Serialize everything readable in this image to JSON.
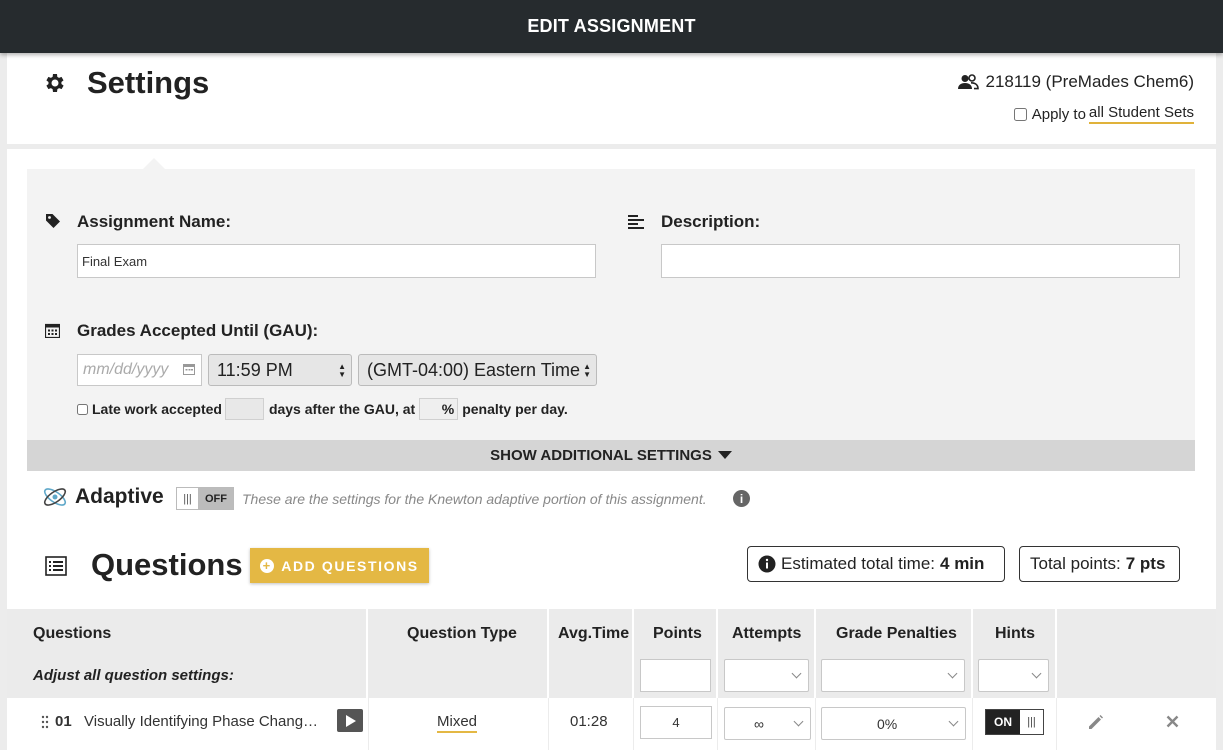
{
  "header": {
    "title": "EDIT ASSIGNMENT"
  },
  "settings": {
    "title": "Settings",
    "student_set": "218119 (PreMades Chem6)",
    "apply_prefix": "Apply to",
    "apply_link": "all Student Sets"
  },
  "form": {
    "name_label": "Assignment Name:",
    "name_value": "Final Exam",
    "description_label": "Description:",
    "description_value": "",
    "gau_label": "Grades Accepted Until (GAU):",
    "date_placeholder": "mm/dd/yyyy",
    "time_value": "11:59 PM",
    "timezone_value": "(GMT-04:00) Eastern Time",
    "late_label": "Late work accepted",
    "late_mid": "days after the GAU, at",
    "late_pct": "%",
    "late_end": "penalty per day."
  },
  "show_more": "SHOW ADDITIONAL SETTINGS",
  "adaptive": {
    "title": "Adaptive",
    "toggle_state": "OFF",
    "toggle_grip": "|||",
    "description": "These are the settings for the Knewton adaptive portion of this assignment.",
    "info_glyph": "i"
  },
  "questions": {
    "title": "Questions",
    "add_button": "ADD QUESTIONS",
    "est_label": "Estimated total time:",
    "est_value": "4 min",
    "pts_label": "Total points:",
    "pts_value": "7 pts"
  },
  "table": {
    "columns": {
      "questions": "Questions",
      "type": "Question Type",
      "avg": "Avg.Time",
      "points": "Points",
      "attempts": "Attempts",
      "penalties": "Grade Penalties",
      "hints": "Hints"
    },
    "adjust_label": "Adjust all question settings:",
    "rows": [
      {
        "number": "01",
        "title": "Visually Identifying Phase Chang…",
        "type": "Mixed",
        "avg_time": "01:28",
        "points": "4",
        "attempts": "∞",
        "penalty": "0%",
        "hints_state": "ON",
        "hints_grip": "|||"
      }
    ]
  },
  "colors": {
    "accent": "#e4b844",
    "topbar": "#262b2e"
  }
}
